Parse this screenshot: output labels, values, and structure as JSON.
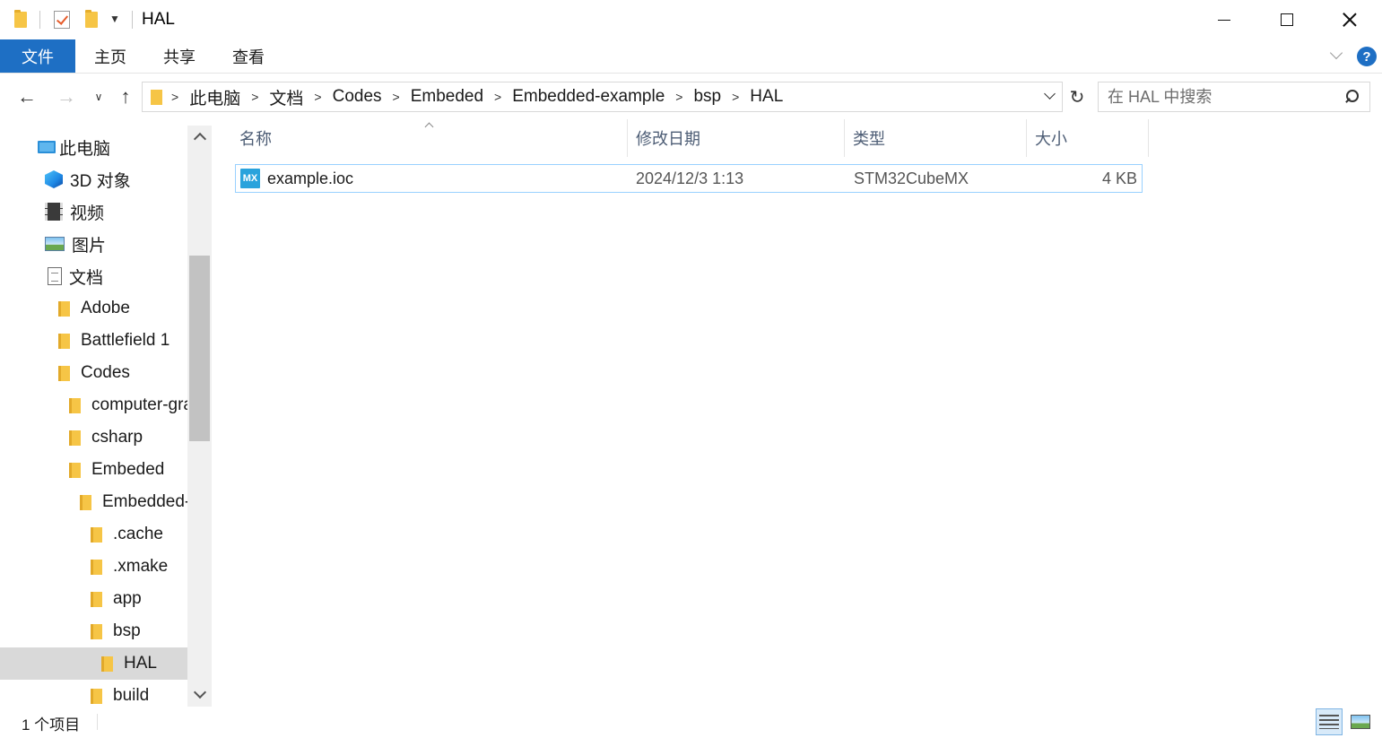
{
  "window": {
    "title": "HAL",
    "minimize_icon": "minimize-icon",
    "maximize_icon": "maximize-icon",
    "close_icon": "close-icon"
  },
  "ribbon": {
    "tabs": [
      "文件",
      "主页",
      "共享",
      "查看"
    ],
    "help_label": "?"
  },
  "address": {
    "crumbs": [
      "此电脑",
      "文档",
      "Codes",
      "Embeded",
      "Embedded-example",
      "bsp",
      "HAL"
    ],
    "search_placeholder": "在 HAL 中搜索"
  },
  "nav_tree": {
    "items": [
      {
        "label": "此电脑",
        "icon": "computer-icon"
      },
      {
        "label": "3D 对象",
        "icon": "3d-objects-icon"
      },
      {
        "label": "视频",
        "icon": "video-icon"
      },
      {
        "label": "图片",
        "icon": "pictures-icon"
      },
      {
        "label": "文档",
        "icon": "documents-icon"
      },
      {
        "label": "Adobe",
        "icon": "folder-icon"
      },
      {
        "label": "Battlefield 1",
        "icon": "folder-icon"
      },
      {
        "label": "Codes",
        "icon": "folder-icon"
      },
      {
        "label": "computer-graphics",
        "icon": "folder-icon"
      },
      {
        "label": "csharp",
        "icon": "folder-icon"
      },
      {
        "label": "Embeded",
        "icon": "folder-icon"
      },
      {
        "label": "Embedded-example",
        "icon": "folder-icon"
      },
      {
        "label": ".cache",
        "icon": "folder-icon"
      },
      {
        "label": ".xmake",
        "icon": "folder-icon"
      },
      {
        "label": "app",
        "icon": "folder-icon"
      },
      {
        "label": "bsp",
        "icon": "folder-icon"
      },
      {
        "label": "HAL",
        "icon": "folder-icon",
        "selected": true
      },
      {
        "label": "build",
        "icon": "folder-icon"
      }
    ]
  },
  "file_list": {
    "columns": [
      "名称",
      "修改日期",
      "类型",
      "大小"
    ],
    "rows": [
      {
        "name": "example.ioc",
        "icon_text": "MX",
        "modified": "2024/12/3 1:13",
        "type": "STM32CubeMX",
        "size": "4 KB"
      }
    ]
  },
  "status": {
    "item_count": "1 个项目"
  },
  "colors": {
    "accent": "#1e6fc4",
    "folder": "#f6c546",
    "selection_border": "#99d1ff",
    "tree_selected": "#d9d9d9"
  }
}
